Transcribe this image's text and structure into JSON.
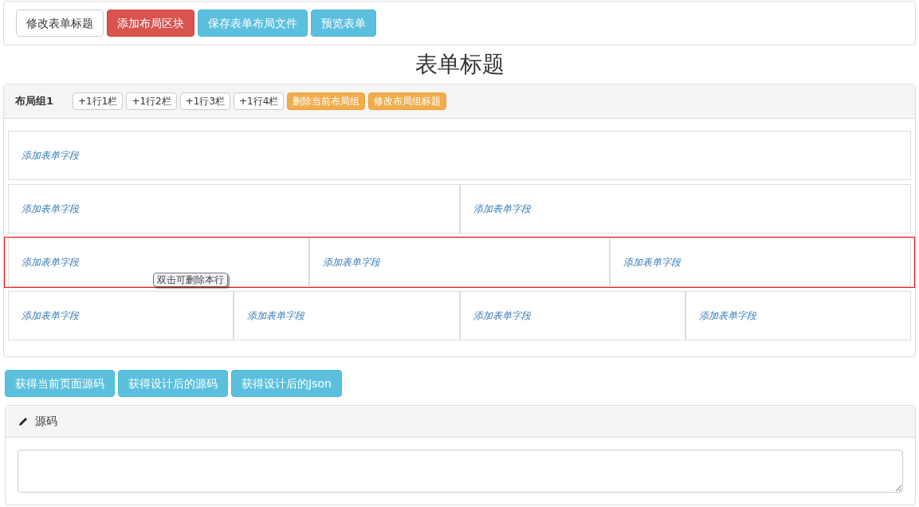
{
  "toolbar": [
    {
      "label": "修改表单标题",
      "kind": "default"
    },
    {
      "label": "添加布局区块",
      "kind": "danger"
    },
    {
      "label": "保存表单布局文件",
      "kind": "info"
    },
    {
      "label": "预览表单",
      "kind": "info"
    }
  ],
  "form_title": "表单标题",
  "layout_group": {
    "title": "布局组1",
    "actions": [
      {
        "label": "+1行1栏",
        "kind": "default"
      },
      {
        "label": "+1行2栏",
        "kind": "default"
      },
      {
        "label": "+1行3栏",
        "kind": "default"
      },
      {
        "label": "+1行4栏",
        "kind": "default"
      },
      {
        "label": "删除当前布局组",
        "kind": "warning"
      },
      {
        "label": "修改布局组标题",
        "kind": "warning"
      }
    ],
    "rows": [
      {
        "selected": false,
        "cells": [
          "添加表单字段"
        ]
      },
      {
        "selected": false,
        "cells": [
          "添加表单字段",
          "添加表单字段"
        ]
      },
      {
        "selected": true,
        "cells": [
          "添加表单字段",
          "添加表单字段",
          "添加表单字段"
        ],
        "tooltip": "双击可删除本行"
      },
      {
        "selected": false,
        "cells": [
          "添加表单字段",
          "添加表单字段",
          "添加表单字段",
          "添加表单字段"
        ]
      }
    ]
  },
  "source_buttons": [
    {
      "label": "获得当前页面源码",
      "kind": "info"
    },
    {
      "label": "获得设计后的源码",
      "kind": "info"
    },
    {
      "label": "获得设计后的Json",
      "kind": "info"
    }
  ],
  "source_panel": {
    "title": "源码"
  }
}
